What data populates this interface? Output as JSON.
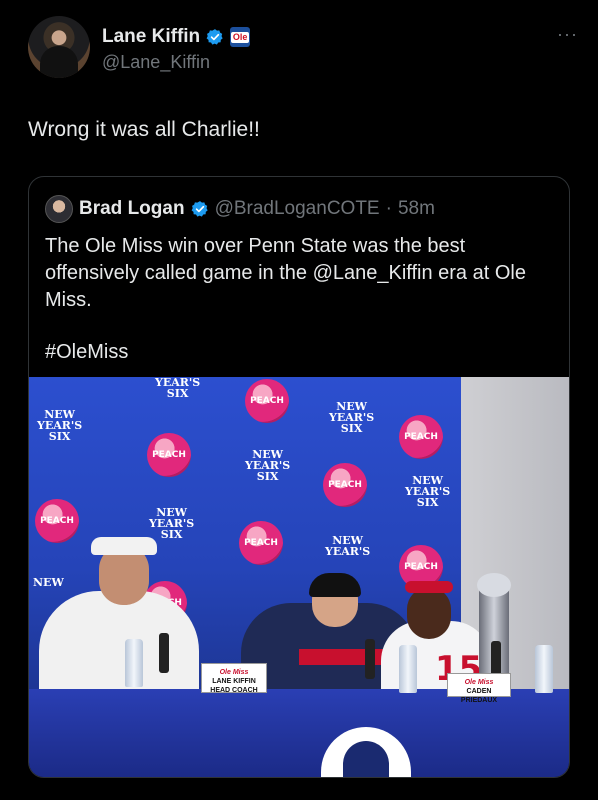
{
  "author": {
    "display_name": "Lane Kiffin",
    "handle": "@Lane_Kiffin",
    "badge_text": "Ole"
  },
  "more_label": "···",
  "tweet": {
    "text": "Wrong it was all Charlie!!"
  },
  "quoted": {
    "display_name": "Brad Logan",
    "handle": "@BradLoganCOTE",
    "separator": "·",
    "time": "58m",
    "text": "The Ole Miss win over Penn State was the best offensively called game in the @Lane_Kiffin era at Ole Miss.",
    "hashtag": "#OleMiss"
  },
  "photo": {
    "backdrop_label": [
      "NEW",
      "YEAR'S",
      "SIX"
    ],
    "sponsor_label": "PEACH",
    "nameplate_left": {
      "team": "Ole Miss",
      "name": "LANE KIFFIN",
      "title": "HEAD COACH"
    },
    "nameplate_right": {
      "team": "Ole Miss",
      "name": "CADEN PRIEDAUX"
    },
    "jersey_number": "15",
    "colors": {
      "backdrop": "#2c4fcf",
      "accent": "#c8102e"
    }
  },
  "colors": {
    "background": "#000000",
    "text": "#e7e9ea",
    "muted": "#71767b",
    "verified": "#1d9bf0",
    "border": "#2f3336"
  }
}
